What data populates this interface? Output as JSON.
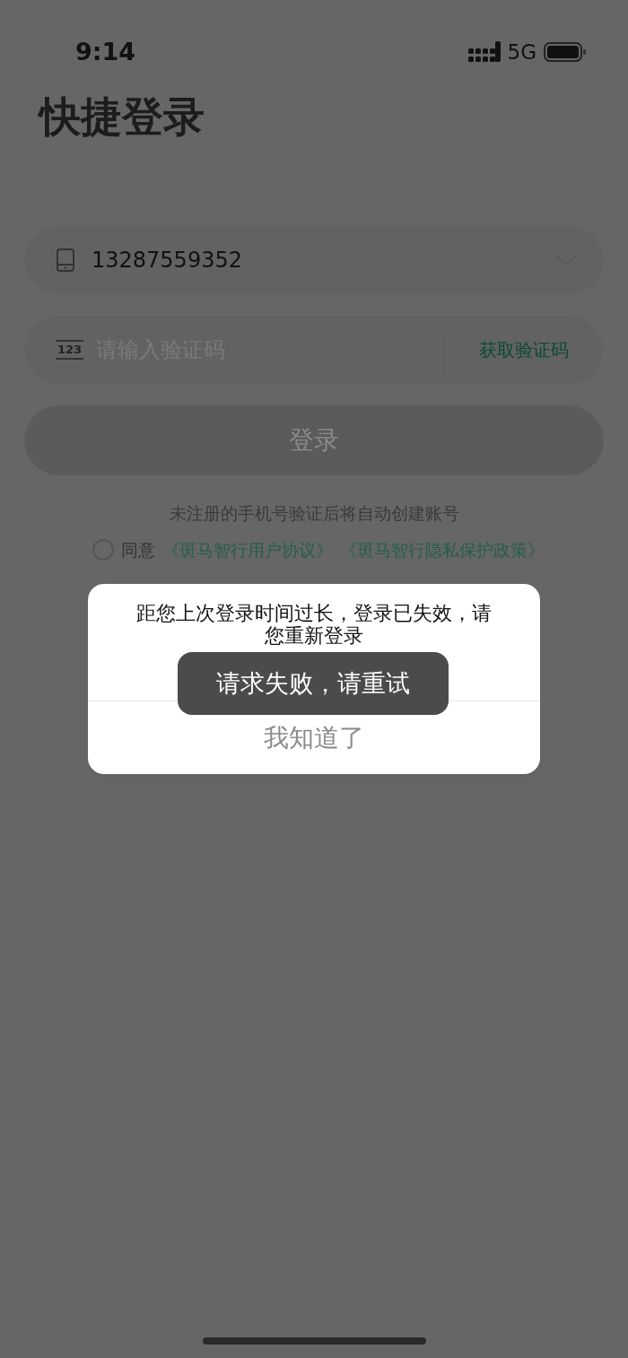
{
  "status_bar": {
    "time": "9:14",
    "network": "5G"
  },
  "title": "快捷登录",
  "phone_field": {
    "value": "13287559352"
  },
  "code_field": {
    "icon_text": "123",
    "placeholder": "请输入验证码",
    "action": "获取验证码"
  },
  "login_button": {
    "label": "登录",
    "disabled": true
  },
  "hint": "未注册的手机号验证后将自动创建账号",
  "agreement": {
    "checked": false,
    "text": "同意",
    "links": [
      "《斑马智行用户协议》",
      "《斑马智行隐私保护政策》"
    ]
  },
  "dialog": {
    "message": "距您上次登录时间过长，登录已失效，请您重新登录",
    "button": "我知道了"
  },
  "toast": {
    "message": "请求失败，请重试"
  }
}
